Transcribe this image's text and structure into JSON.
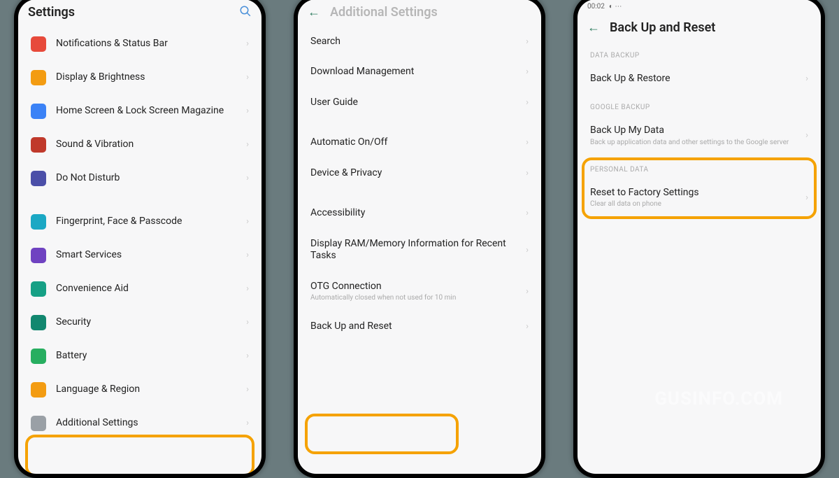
{
  "watermark": "GUSINFO.COM",
  "phone1": {
    "title": "Settings",
    "items": [
      {
        "icon": "ic-red",
        "label": "Notifications & Status Bar"
      },
      {
        "icon": "ic-orange",
        "label": "Display & Brightness"
      },
      {
        "icon": "ic-blue",
        "label": "Home Screen & Lock Screen Magazine"
      },
      {
        "icon": "ic-dred",
        "label": "Sound & Vibration"
      },
      {
        "icon": "ic-indigo",
        "label": "Do Not Disturb"
      },
      {
        "gap": true
      },
      {
        "icon": "ic-cyan",
        "label": "Fingerprint, Face & Passcode"
      },
      {
        "icon": "ic-purple",
        "label": "Smart Services"
      },
      {
        "icon": "ic-teal",
        "label": "Convenience Aid"
      },
      {
        "icon": "ic-dteal",
        "label": "Security"
      },
      {
        "icon": "ic-green",
        "label": "Battery"
      },
      {
        "icon": "ic-orange",
        "label": "Language & Region"
      },
      {
        "icon": "ic-gray",
        "label": "Additional Settings",
        "highlighted": true
      }
    ]
  },
  "phone2": {
    "title": "Additional Settings",
    "items": [
      {
        "label": "Search"
      },
      {
        "label": "Download Management"
      },
      {
        "label": "User Guide"
      },
      {
        "gap": true
      },
      {
        "label": "Automatic On/Off"
      },
      {
        "label": "Device & Privacy"
      },
      {
        "gap": true
      },
      {
        "label": "Accessibility"
      },
      {
        "label": "Display RAM/Memory Information for Recent Tasks"
      },
      {
        "label": "OTG Connection",
        "sub": "Automatically closed when not used for 10 min"
      },
      {
        "label": "Back Up and Reset",
        "highlighted": true
      }
    ]
  },
  "phone3": {
    "status_time": "00:02",
    "title": "Back Up and Reset",
    "sections": [
      {
        "header": "DATA BACKUP",
        "items": [
          {
            "label": "Back Up & Restore"
          }
        ]
      },
      {
        "header": "GOOGLE BACKUP",
        "items": [
          {
            "label": "Back Up My Data",
            "sub": "Back up application data and other settings to the Google server"
          }
        ]
      },
      {
        "header": "PERSONAL DATA",
        "highlighted": true,
        "items": [
          {
            "label": "Reset to Factory Settings",
            "sub": "Clear all data on phone"
          }
        ]
      }
    ]
  }
}
